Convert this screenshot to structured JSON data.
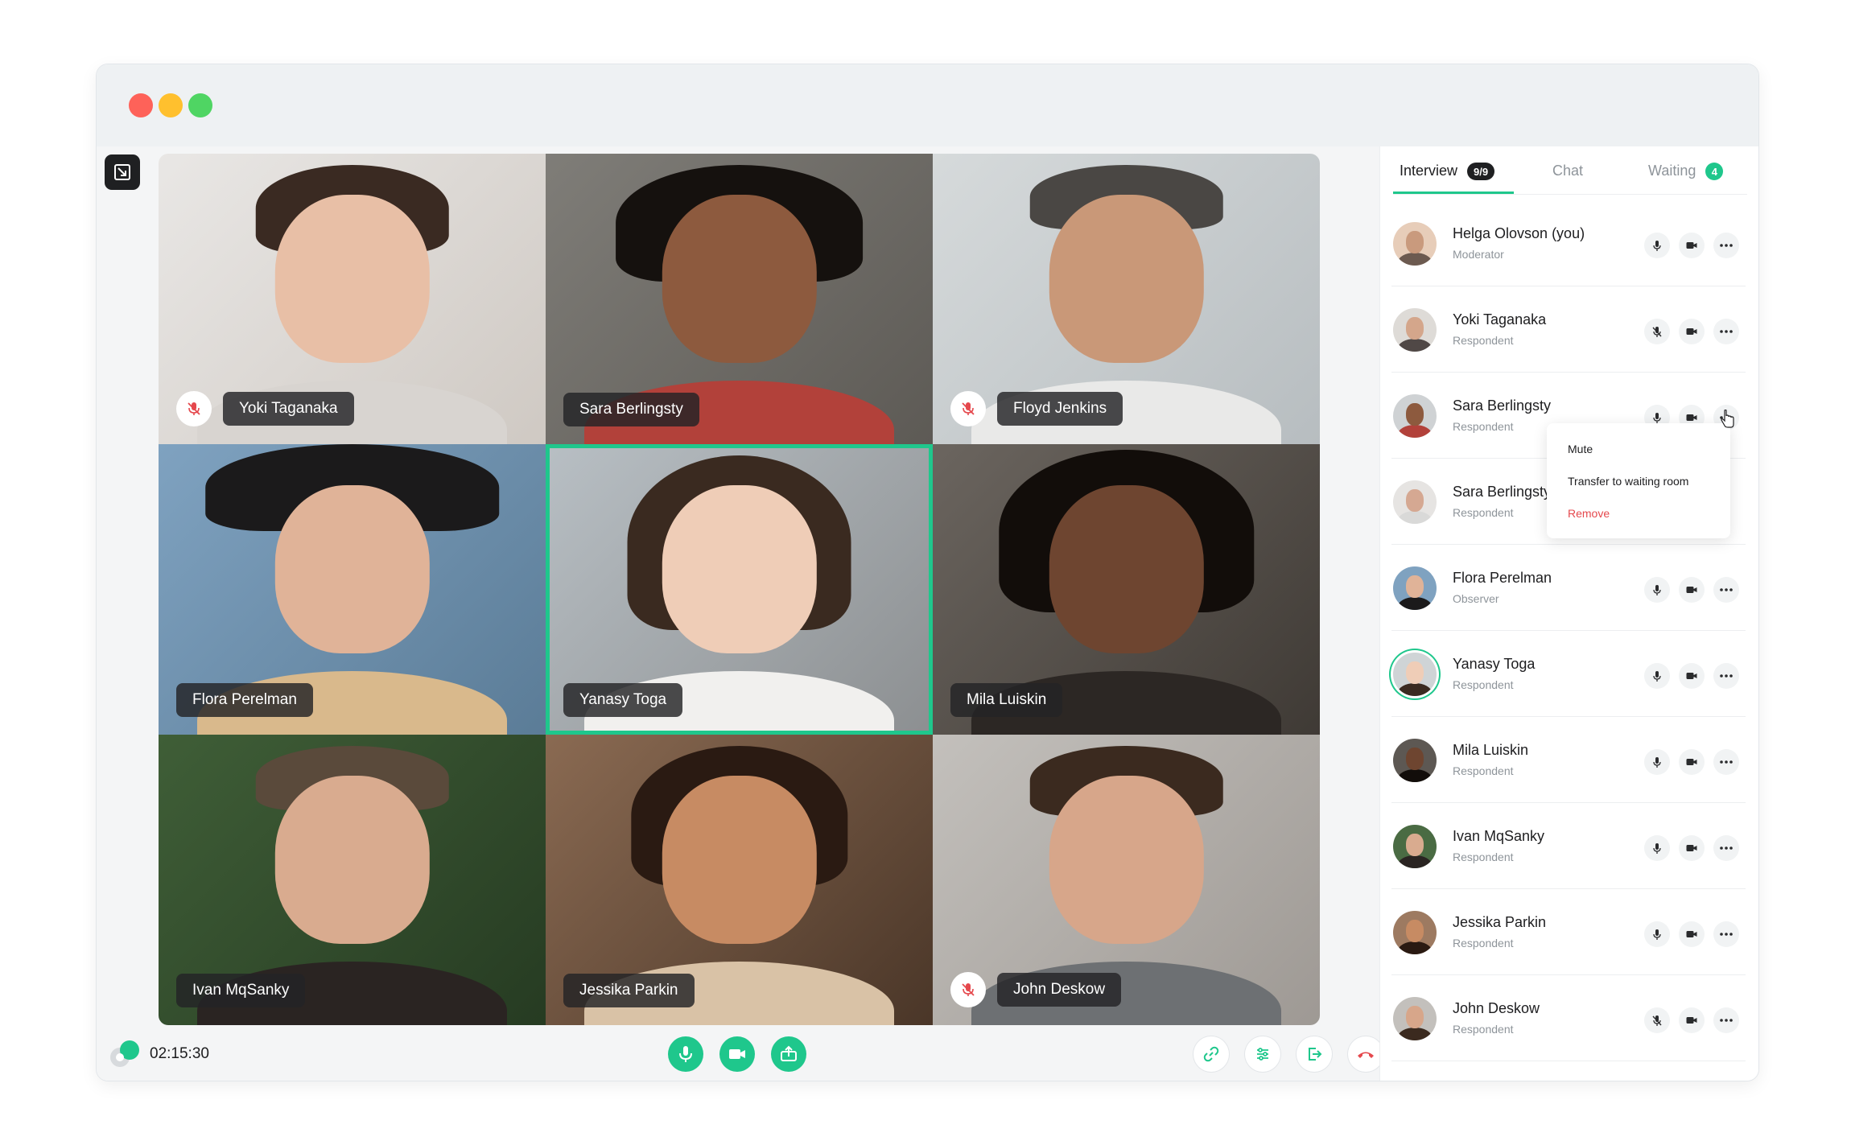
{
  "window": {
    "controls": [
      "close",
      "minimize",
      "maximize"
    ]
  },
  "colors": {
    "accent": "#1fc78c",
    "danger": "#e5484d",
    "close": "#fe6259",
    "minimize": "#ffc02e",
    "maximize": "#4fd563"
  },
  "tiles": [
    {
      "name": "Yoki Taganaka",
      "muted": true
    },
    {
      "name": "Sara Berlingsty",
      "muted": false
    },
    {
      "name": "Floyd Jenkins",
      "muted": true
    },
    {
      "name": "Flora Perelman",
      "muted": false
    },
    {
      "name": "Yanasy Toga",
      "muted": false,
      "active": true
    },
    {
      "name": "Mila Luiskin",
      "muted": false
    },
    {
      "name": "Ivan MqSanky",
      "muted": false
    },
    {
      "name": "Jessika Parkin",
      "muted": false
    },
    {
      "name": "John Deskow",
      "muted": true
    }
  ],
  "bottom_bar": {
    "timer": "02:15:30",
    "center_controls": [
      "microphone-icon",
      "camera-icon",
      "share-screen-icon"
    ],
    "right_controls": [
      "link-icon",
      "settings-sliders-icon",
      "leave-icon",
      "end-call-icon"
    ]
  },
  "sidebar": {
    "tabs": [
      {
        "label": "Interview",
        "badge": "9/9",
        "active": true
      },
      {
        "label": "Chat",
        "badge": "",
        "active": false
      },
      {
        "label": "Waiting",
        "badge": "4",
        "active": false
      }
    ],
    "participants": [
      {
        "name": "Helga Olovson (you)",
        "role": "Moderator",
        "mic_muted": false
      },
      {
        "name": "Yoki Taganaka",
        "role": "Respondent",
        "mic_muted": true
      },
      {
        "name": "Sara Berlingsty",
        "role": "Respondent",
        "mic_muted": false,
        "menu_open": true
      },
      {
        "name": "Sara Berlingsty",
        "role": "Respondent",
        "mic_muted": false
      },
      {
        "name": "Flora Perelman",
        "role": "Observer",
        "mic_muted": false
      },
      {
        "name": "Yanasy Toga",
        "role": "Respondent",
        "mic_muted": false,
        "highlighted": true
      },
      {
        "name": "Mila Luiskin",
        "role": "Respondent",
        "mic_muted": false
      },
      {
        "name": "Ivan MqSanky",
        "role": "Respondent",
        "mic_muted": false
      },
      {
        "name": "Jessika Parkin",
        "role": "Respondent",
        "mic_muted": false
      },
      {
        "name": "John Deskow",
        "role": "Respondent",
        "mic_muted": true
      }
    ]
  },
  "context_menu": {
    "items": [
      {
        "label": "Mute",
        "danger": false
      },
      {
        "label": "Transfer to waiting room",
        "danger": false
      },
      {
        "label": "Remove",
        "danger": true
      }
    ]
  }
}
